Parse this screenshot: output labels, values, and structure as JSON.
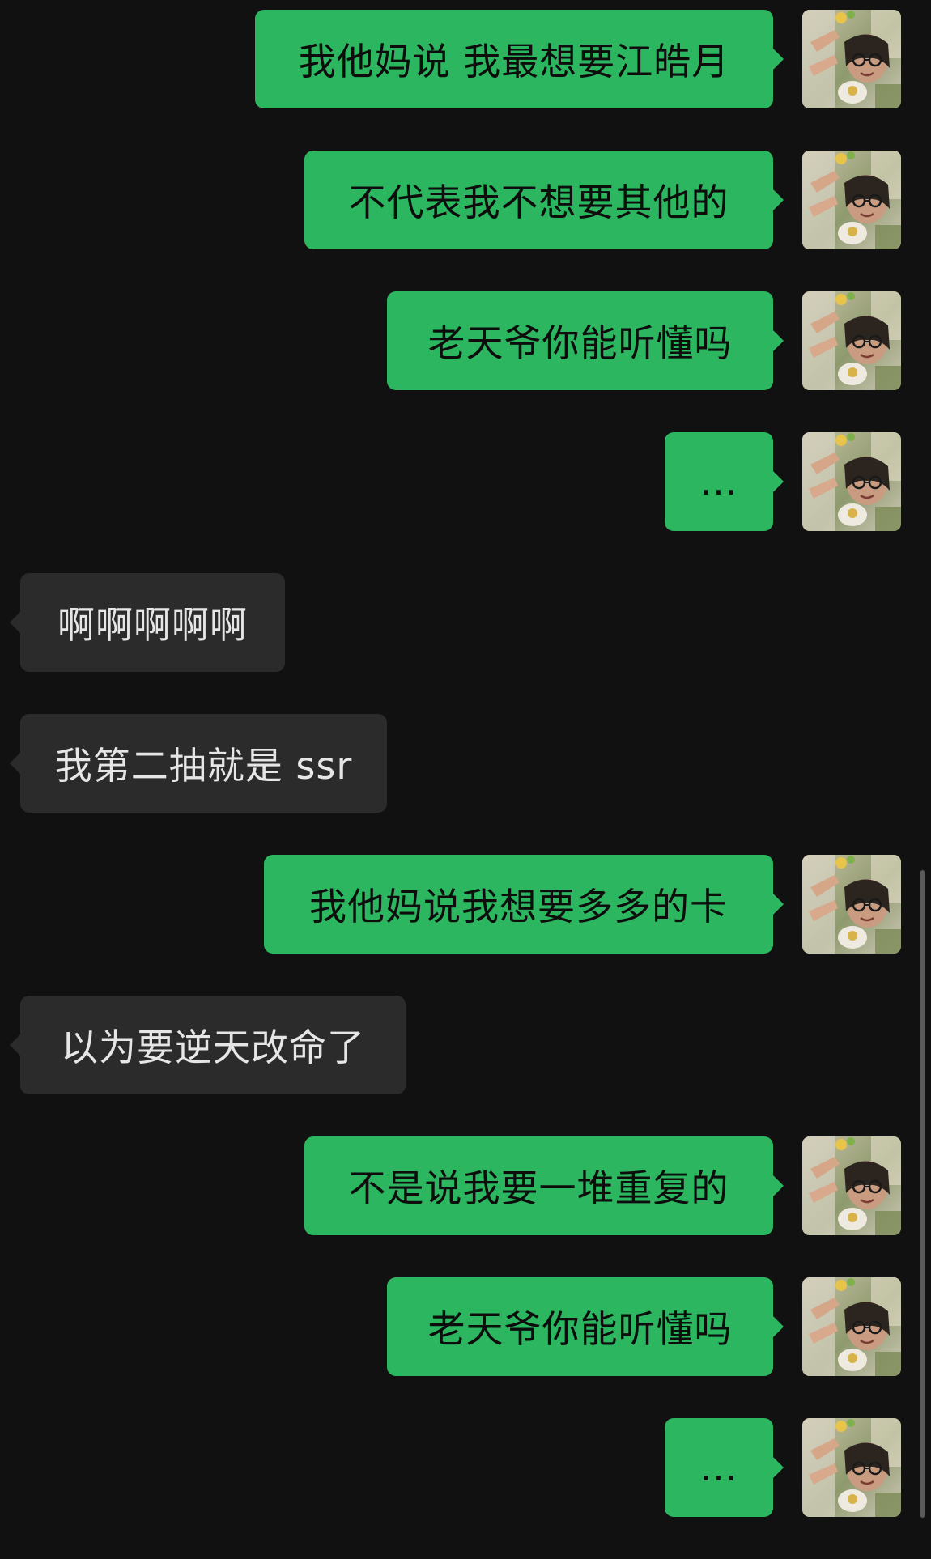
{
  "theme": {
    "background": "#111111",
    "outgoing_bubble": "#2bb65f",
    "incoming_bubble": "#2b2b2b",
    "outgoing_text": "#0d0d0d",
    "incoming_text": "#e6e6e6"
  },
  "messages": [
    {
      "side": "out",
      "text": "我他妈说 我最想要江皓月",
      "avatar_icon": "user-avatar-icon"
    },
    {
      "side": "out",
      "text": "不代表我不想要其他的",
      "avatar_icon": "user-avatar-icon"
    },
    {
      "side": "out",
      "text": "老天爷你能听懂吗",
      "avatar_icon": "user-avatar-icon"
    },
    {
      "side": "out",
      "text": "...",
      "avatar_icon": "user-avatar-icon"
    },
    {
      "side": "in",
      "text": "啊啊啊啊啊"
    },
    {
      "side": "in",
      "text": "我第二抽就是 ssr"
    },
    {
      "side": "out",
      "text": "我他妈说我想要多多的卡",
      "avatar_icon": "user-avatar-icon"
    },
    {
      "side": "in",
      "text": "以为要逆天改命了"
    },
    {
      "side": "out",
      "text": "不是说我要一堆重复的",
      "avatar_icon": "user-avatar-icon"
    },
    {
      "side": "out",
      "text": "老天爷你能听懂吗",
      "avatar_icon": "user-avatar-icon"
    },
    {
      "side": "out",
      "text": "...",
      "avatar_icon": "user-avatar-icon"
    }
  ]
}
